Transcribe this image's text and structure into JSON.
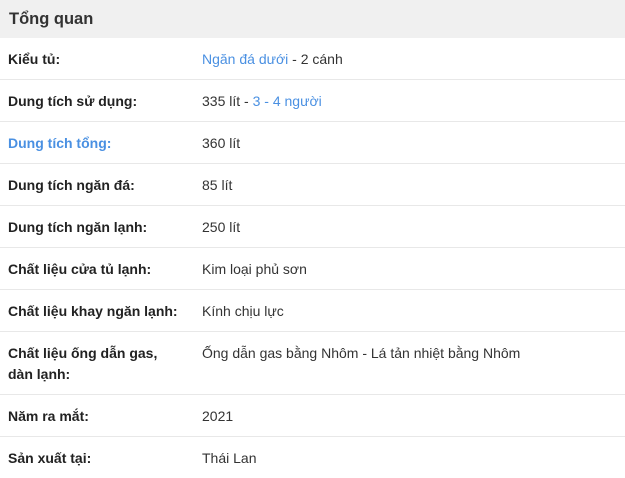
{
  "panel": {
    "title": "Tổng quan"
  },
  "rows": [
    {
      "label": "Kiểu tủ:",
      "value_link": "Ngăn đá dưới",
      "value_rest": " - 2 cánh"
    },
    {
      "label": "Dung tích sử dụng:",
      "value_pre": "335 lít",
      "value_sep": " - ",
      "value_link": "3 - 4 người"
    },
    {
      "label": "Dung tích tổng:",
      "value": "360 lít"
    },
    {
      "label": "Dung tích ngăn đá:",
      "value": "85 lít"
    },
    {
      "label": "Dung tích ngăn lạnh:",
      "value": "250 lít"
    },
    {
      "label": "Chất liệu cửa tủ lạnh:",
      "value": "Kim loại phủ sơn"
    },
    {
      "label": "Chất liệu khay ngăn lạnh:",
      "value": "Kính chịu lực"
    },
    {
      "label": "Chất liệu ống dẫn gas, dàn lạnh:",
      "value": "Ống dẫn gas bằng Nhôm - Lá tản nhiệt bằng Nhôm"
    },
    {
      "label": "Năm ra mắt:",
      "value": "2021"
    },
    {
      "label": "Sản xuất tại:",
      "value": "Thái Lan"
    }
  ],
  "colors": {
    "header_bg": "#f0f0f0",
    "link": "#4a90e2",
    "divider": "#e8e8e8"
  }
}
